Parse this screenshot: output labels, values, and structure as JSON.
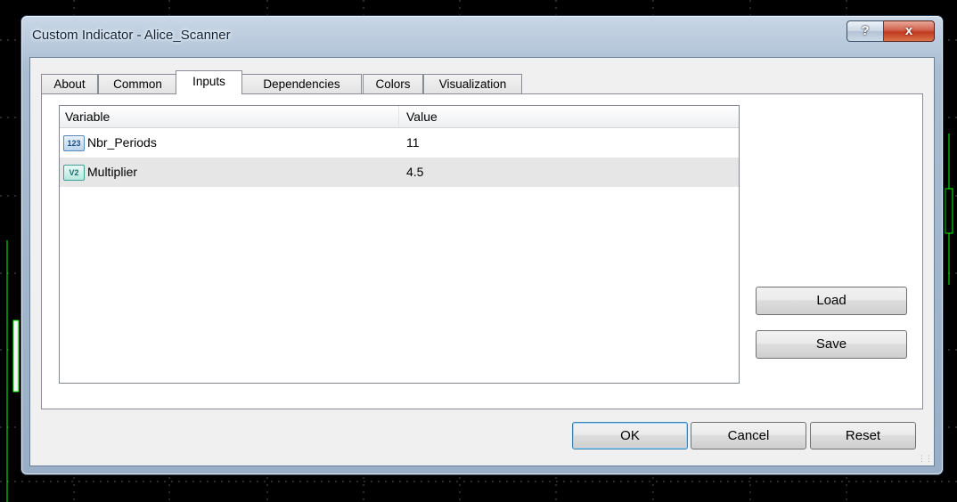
{
  "window": {
    "title": "Custom Indicator - Alice_Scanner",
    "help_label": "?",
    "close_label": "x"
  },
  "tabs": [
    {
      "label": "About"
    },
    {
      "label": "Common"
    },
    {
      "label": "Inputs"
    },
    {
      "label": "Dependencies"
    },
    {
      "label": "Colors"
    },
    {
      "label": "Visualization"
    }
  ],
  "active_tab": "Inputs",
  "table": {
    "columns": [
      "Variable",
      "Value"
    ],
    "rows": [
      {
        "icon": "integer-type-icon",
        "icon_text": "123",
        "name": "Nbr_Periods",
        "value": "11"
      },
      {
        "icon": "double-type-icon",
        "icon_text": "V2",
        "name": "Multiplier",
        "value": "4.5"
      }
    ]
  },
  "side_buttons": {
    "load": "Load",
    "save": "Save"
  },
  "footer_buttons": {
    "ok": "OK",
    "cancel": "Cancel",
    "reset": "Reset"
  },
  "colors": {
    "chart_grid": "#4d4d4d",
    "candle": "#00ff00",
    "close_button": "#c0391f"
  }
}
